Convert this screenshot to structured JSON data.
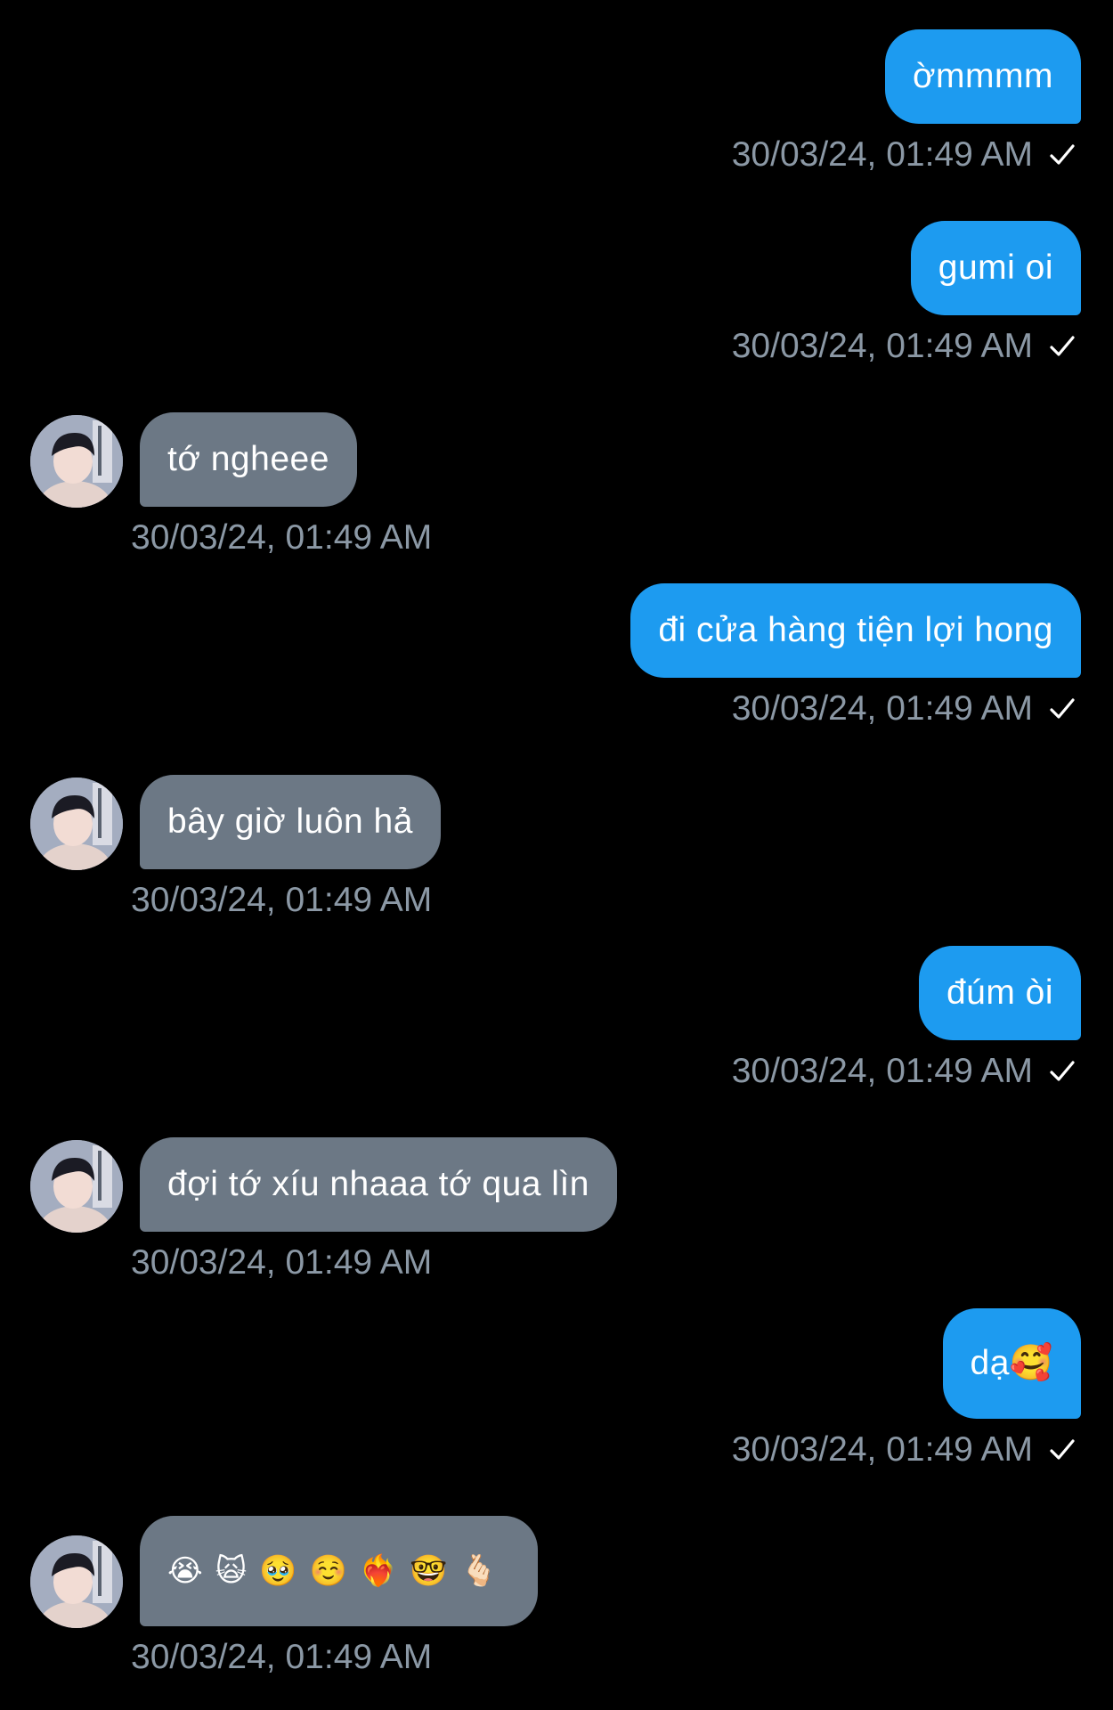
{
  "colors": {
    "background": "#000000",
    "outgoing_bubble": "#1d9bf0",
    "incoming_bubble": "#6c7885",
    "timestamp": "#8b98a5"
  },
  "messages": [
    {
      "direction": "outgoing",
      "text": "ờmmmm",
      "time": "30/03/24, 01:49 AM",
      "status_icon": "check-icon"
    },
    {
      "direction": "outgoing",
      "text": "gumi oi",
      "time": "30/03/24, 01:49 AM",
      "status_icon": "check-icon"
    },
    {
      "direction": "incoming",
      "text": "tớ ngheee",
      "time": "30/03/24, 01:49 AM",
      "avatar": "avatar-icon"
    },
    {
      "direction": "outgoing",
      "text": "đi cửa hàng tiện lợi hong",
      "time": "30/03/24, 01:49 AM",
      "status_icon": "check-icon"
    },
    {
      "direction": "incoming",
      "text": "bây giờ luôn hả",
      "time": "30/03/24, 01:49 AM",
      "avatar": "avatar-icon"
    },
    {
      "direction": "outgoing",
      "text": "đúm òi",
      "time": "30/03/24, 01:49 AM",
      "status_icon": "check-icon"
    },
    {
      "direction": "incoming",
      "text": "đợi tớ xíu nhaaa tớ qua lìn",
      "time": "30/03/24, 01:49 AM",
      "avatar": "avatar-icon"
    },
    {
      "direction": "outgoing",
      "text": "dạ🥰",
      "time": "30/03/24, 01:49 AM",
      "status_icon": "check-icon"
    },
    {
      "direction": "incoming",
      "text": "😭🙀🥹☺️❤️‍🔥🤓🫰🏻",
      "time": "30/03/24, 01:49 AM",
      "avatar": "avatar-icon"
    }
  ]
}
